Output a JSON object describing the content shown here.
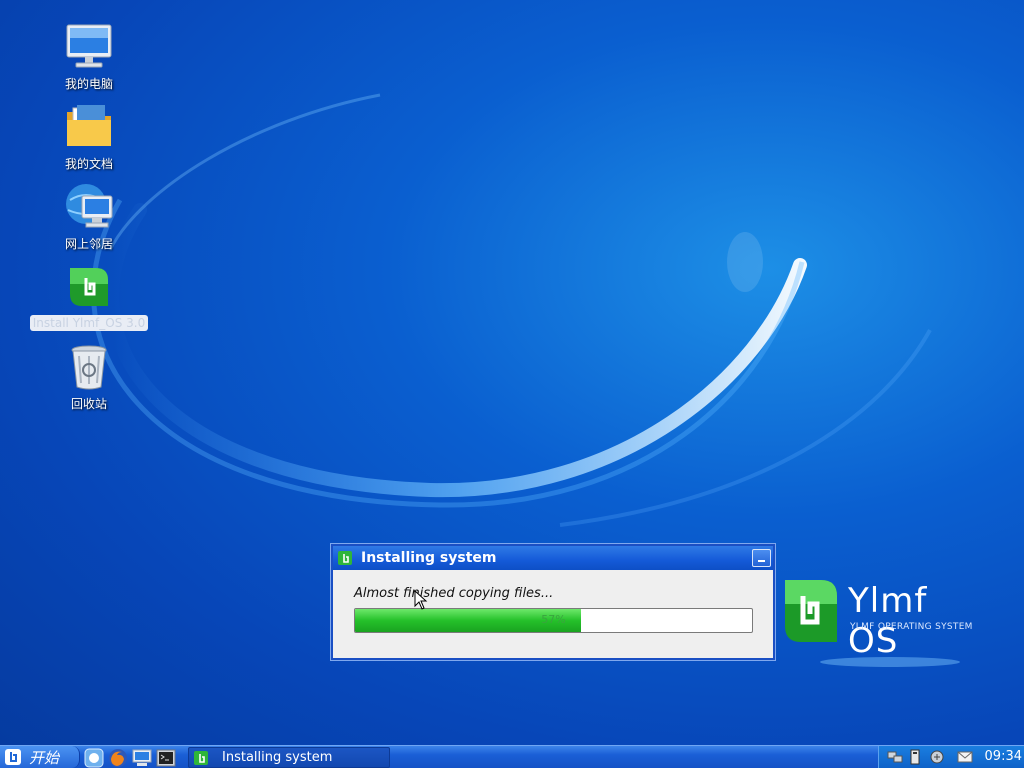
{
  "desktop": {
    "icons": [
      {
        "label": "我的电脑",
        "icon": "computer-icon"
      },
      {
        "label": "我的文档",
        "icon": "folder-icon"
      },
      {
        "label": "网上邻居",
        "icon": "network-icon"
      },
      {
        "label": "Install Ylmf_OS 3.0",
        "icon": "installer-icon"
      },
      {
        "label": "回收站",
        "icon": "trash-icon"
      }
    ]
  },
  "dialog": {
    "title": "Installing system",
    "status": "Almost finished copying files...",
    "progress_percent": 57,
    "progress_label": "57%"
  },
  "logo": {
    "brand": "Ylmf OS",
    "tagline": "YLMF OPERATING SYSTEM"
  },
  "taskbar": {
    "start_label": "开始",
    "quick_launch": [
      "finder-icon",
      "firefox-icon",
      "desktop-icon",
      "terminal-icon"
    ],
    "task_label": "Installing system",
    "tray_icons": [
      "network-tray-icon",
      "battery-icon",
      "volume-icon",
      "mail-icon"
    ],
    "clock": "09:34"
  },
  "colors": {
    "desktop_blue": "#0a5fd0",
    "titlebar_blue": "#145ad8",
    "progress_green": "#25c12a"
  }
}
